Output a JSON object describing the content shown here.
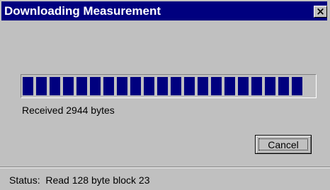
{
  "window": {
    "title": "Downloading Measurement",
    "close_label": "×"
  },
  "progress": {
    "value": 1.0,
    "bar_color": "#00007f"
  },
  "received_text": "Received 2944 bytes",
  "cancel_label": "Cancel",
  "status": {
    "label": "Status:",
    "message": "Read 128 byte block 23"
  }
}
